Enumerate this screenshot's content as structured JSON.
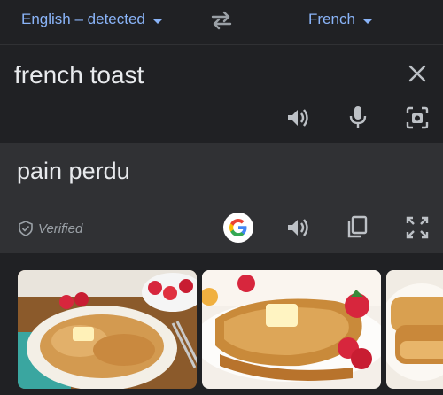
{
  "languages": {
    "source": "English – detected",
    "target": "French"
  },
  "source": {
    "text": "french toast"
  },
  "translation": {
    "text": "pain perdu",
    "verified_label": "Verified"
  },
  "icons": {
    "swap": "swap-icon",
    "clear": "close-icon",
    "speaker": "speaker-icon",
    "mic": "microphone-icon",
    "camera": "camera-icon",
    "google": "google-icon",
    "copy": "copy-icon",
    "fullscreen": "fullscreen-icon",
    "verified": "shield-check-icon"
  },
  "colors": {
    "accent": "#8ab4f8",
    "background": "#202124",
    "translation_bg": "#303134"
  },
  "images": [
    {
      "alt": "french toast image 1"
    },
    {
      "alt": "french toast image 2"
    },
    {
      "alt": "french toast image 3"
    }
  ]
}
